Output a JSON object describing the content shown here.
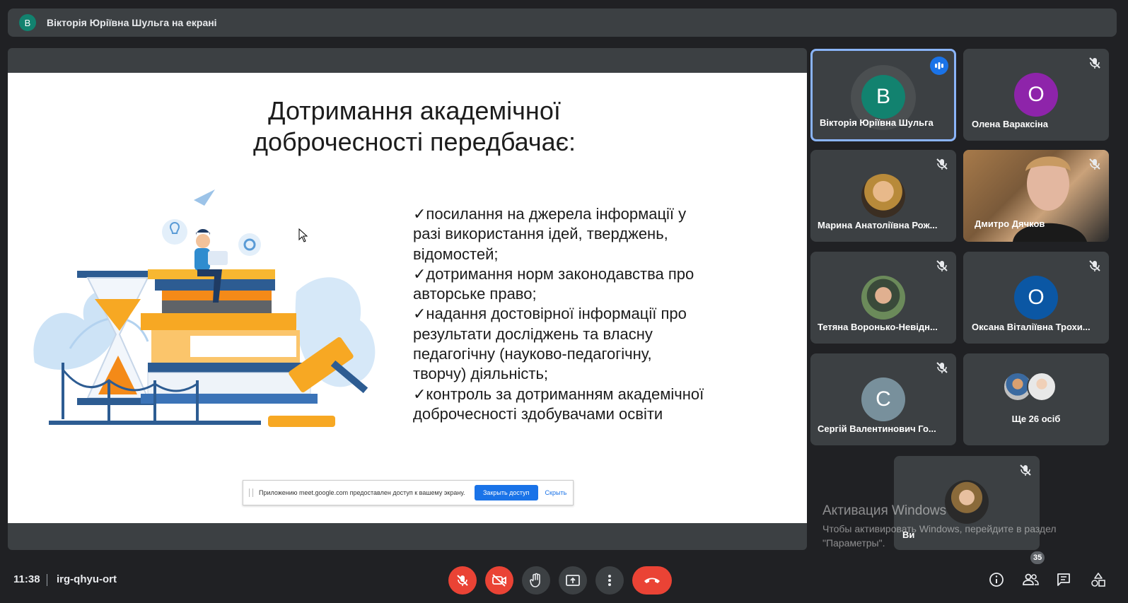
{
  "header": {
    "presenter_initial": "В",
    "presenting_text": "Вікторія Юріївна Шульга на екрані"
  },
  "slide": {
    "title_line1": "Дотримання академічної",
    "title_line2": "доброчесності передбачає:",
    "bullets": [
      "✓посилання на джерела інформації у",
      "разі використання ідей, тверджень,",
      "відомостей;",
      "✓дотримання норм законодавства про",
      "авторське право;",
      "✓надання достовірної інформації про",
      "результати досліджень та власну",
      "педагогічну (науково-педагогічну,",
      "творчу) діяльність;",
      "✓контроль за дотриманням академічної",
      "доброчесності здобувачами освіти"
    ]
  },
  "share_bar": {
    "message": "Приложению meet.google.com предоставлен доступ к вашему экрану.",
    "stop_label": "Закрыть доступ",
    "hide_label": "Скрыть"
  },
  "participants": [
    {
      "initial": "В",
      "name": "Вікторія Юріївна Шульга",
      "color": "#12826f",
      "speaking": true
    },
    {
      "initial": "О",
      "name": "Олена Вараксіна",
      "color": "#8e24aa",
      "muted": true
    },
    {
      "initial": "",
      "name": "Марина Анатоліївна Рож...",
      "muted": true
    },
    {
      "initial": "",
      "name": "Дмитро Дячков",
      "muted": true
    },
    {
      "initial": "",
      "name": "Тетяна Воронько-Невідн...",
      "muted": true
    },
    {
      "initial": "О",
      "name": "Оксана Віталіївна Трохи...",
      "color": "#0b57a4",
      "muted": true
    },
    {
      "initial": "С",
      "name": "Сергій Валентинович Го...",
      "color": "#78909c",
      "muted": true
    },
    {
      "initial": "",
      "name": "Ще 26 осіб"
    },
    {
      "initial": "",
      "name": "Ви",
      "muted": true
    }
  ],
  "windows_activation": {
    "line1": "Активация Windows",
    "line2": "Чтобы активировать Windows, перейдите в раздел",
    "line3": "\"Параметры\"."
  },
  "bottom_bar": {
    "time": "11:38",
    "meeting_code": "irg-qhyu-ort",
    "people_count": "35"
  },
  "colors": {
    "background": "#202124",
    "tile": "#3c4043",
    "danger": "#ea4335",
    "accent": "#1a73e8",
    "active_border": "#8ab4f8"
  }
}
